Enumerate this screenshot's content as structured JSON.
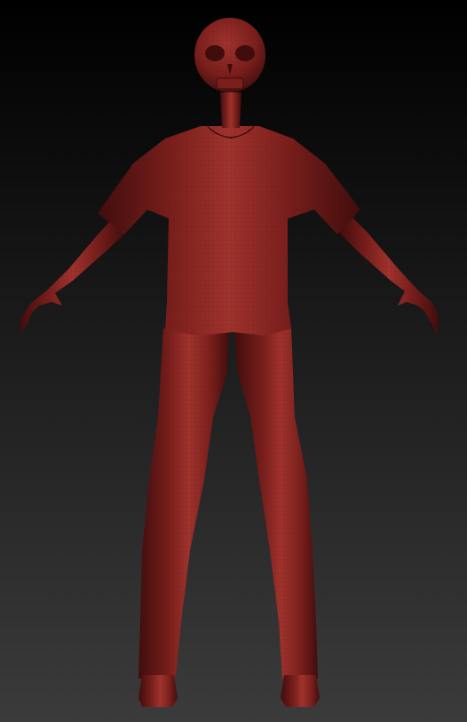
{
  "viewport": {
    "background_top": "#000000",
    "background_bottom": "#3b3b3b"
  },
  "model": {
    "base_color": "#7a1f1c",
    "light_color": "#a0332d",
    "shadow_color": "#3f0d0c",
    "wire_color": "#5a1714"
  }
}
